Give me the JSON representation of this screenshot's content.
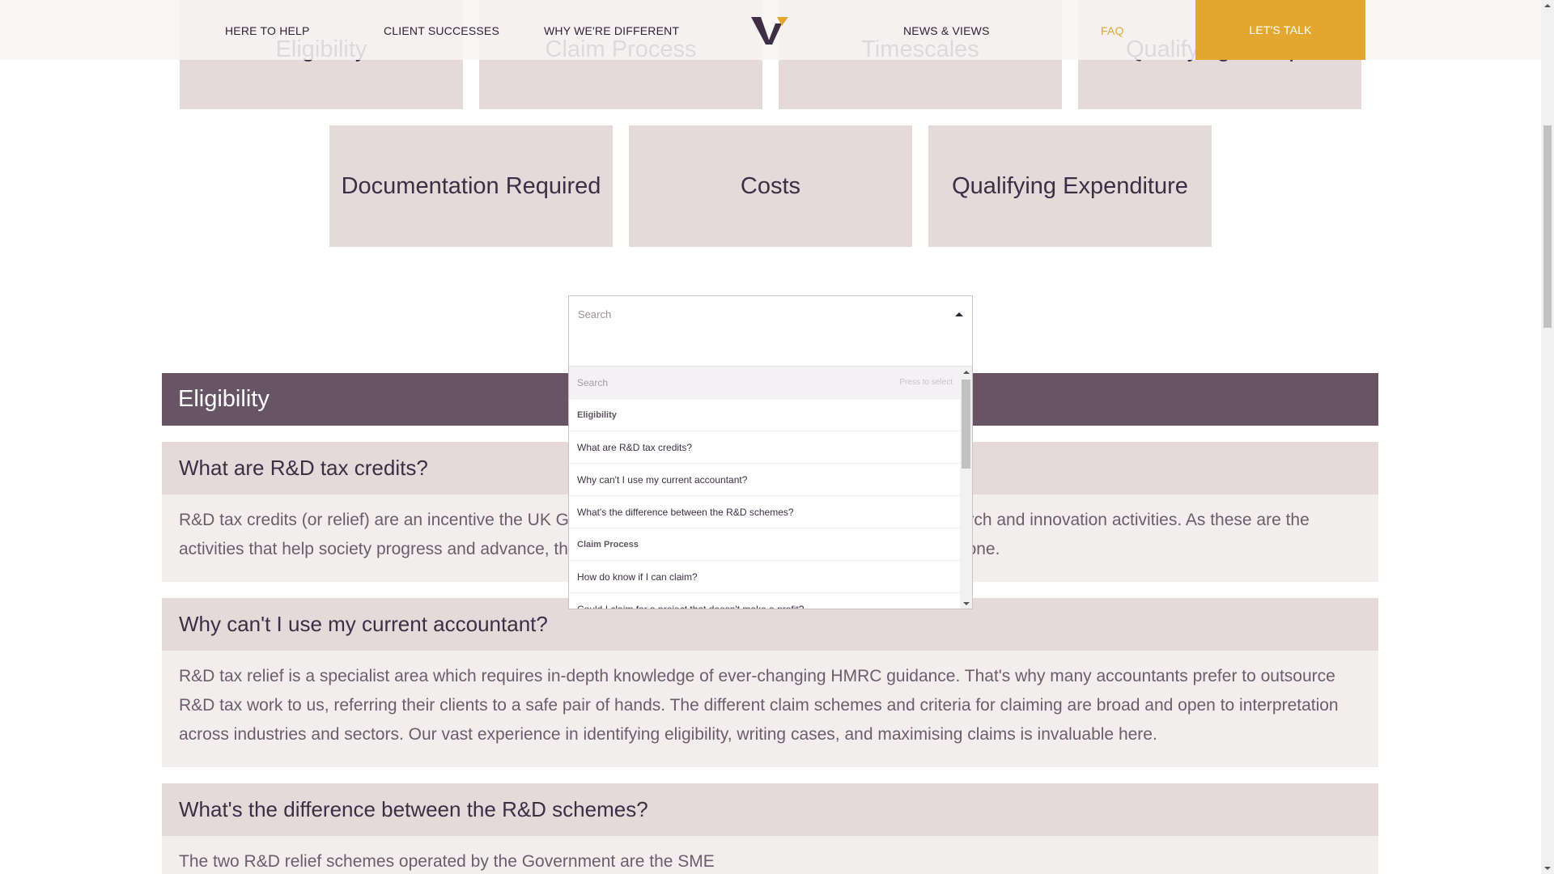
{
  "nav": {
    "items": [
      {
        "label": "HERE TO HELP"
      },
      {
        "label": "CLIENT SUCCESSES"
      },
      {
        "label": "WHY WE'RE DIFFERENT"
      },
      {
        "label": "NEWS & VIEWS"
      },
      {
        "label": "FAQ"
      }
    ],
    "cta_label": "LET'S TALK",
    "logo_icon": "v-logo-icon",
    "active_item": "FAQ",
    "accent_color": "#e3a72f"
  },
  "categories": [
    {
      "label": "Eligibility"
    },
    {
      "label": "Claim Process"
    },
    {
      "label": "Timescales"
    },
    {
      "label": "Qualifying Groups"
    },
    {
      "label": "Documentation Required"
    },
    {
      "label": "Costs"
    },
    {
      "label": "Qualifying Expenditure"
    }
  ],
  "search": {
    "placeholder": "Search",
    "is_open": true,
    "input_value": "",
    "dropdown": {
      "highlighted_label": "Search",
      "highlighted_hint": "Press to select",
      "options": [
        {
          "label": "Eligibility",
          "group": true
        },
        {
          "label": "What are R&D tax credits?"
        },
        {
          "label": "Why can't I use my current accountant?"
        },
        {
          "label": "What's the difference between the R&D schemes?"
        },
        {
          "label": "Claim Process",
          "group": true
        },
        {
          "label": "How do know if I can claim?"
        },
        {
          "label": "Could I claim for a project that doesn't make a profit?"
        }
      ]
    }
  },
  "faq": {
    "section_title": "Eligibility",
    "section_color": "#675566",
    "questions": [
      {
        "question": "What are R&D tax credits?",
        "answer": "R&D tax credits (or relief) are an incentive the UK Government offers to reward companies for their research and innovation activities. As these are the activities that help society progress and advance, the relief is designed to encourage innovation for everyone."
      },
      {
        "question": "Why can't I use my current accountant?",
        "answer": "R&D tax relief is a specialist area which requires in-depth knowledge of ever-changing HMRC guidance. That's why many accountants prefer to outsource R&D tax work to us, referring their clients to a safe pair of hands. The different claim schemes and criteria for claiming are broad and open to interpretation across industries and sectors. Our vast experience in identifying eligibility, writing cases, and maximising claims is invaluable here."
      },
      {
        "question": "What's the difference between the R&D schemes?",
        "answer": "The two R&D relief schemes operated by the Government are the SME"
      }
    ]
  }
}
